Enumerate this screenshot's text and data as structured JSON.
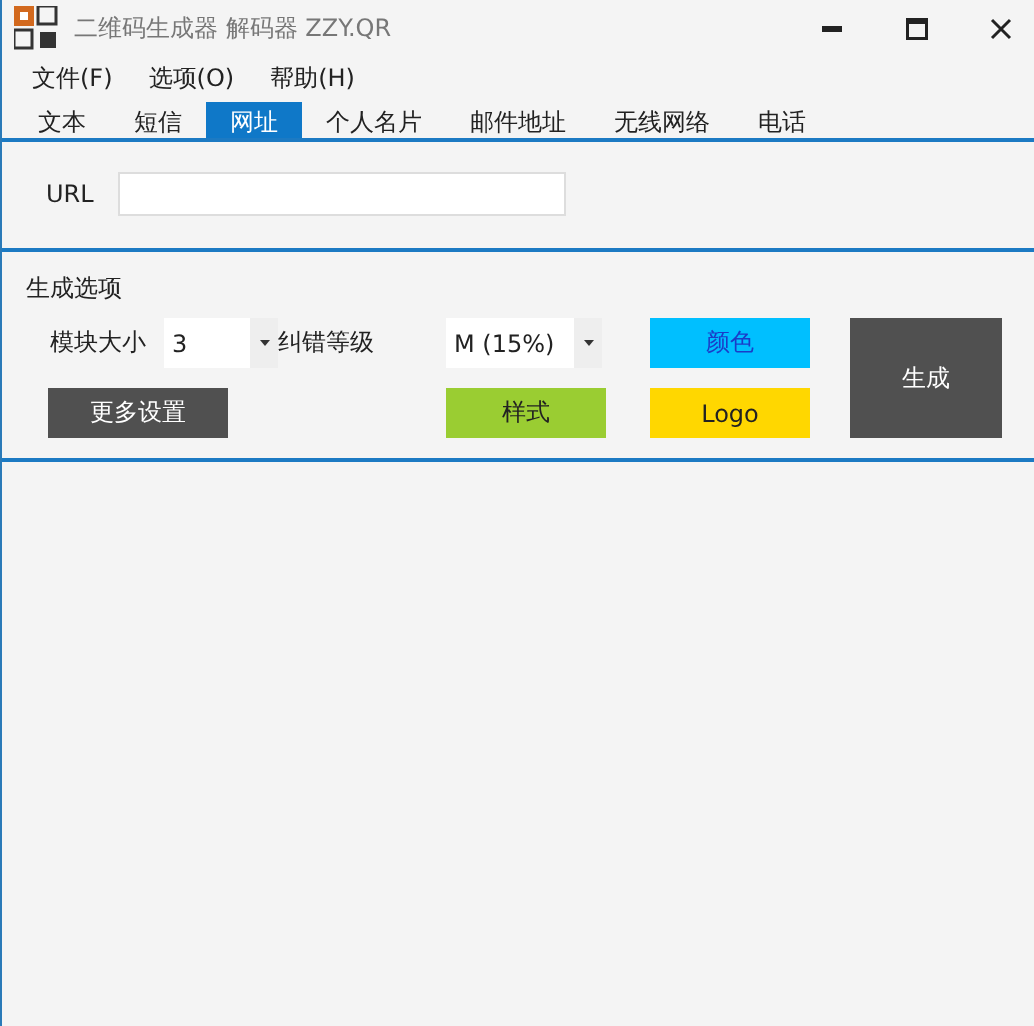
{
  "window": {
    "title": "二维码生成器 解码器 ZZY.QR"
  },
  "menu": [
    "文件(F)",
    "选项(O)",
    "帮助(H)"
  ],
  "tabs": [
    {
      "label": "文本",
      "selected": false
    },
    {
      "label": "短信",
      "selected": false
    },
    {
      "label": "网址",
      "selected": true
    },
    {
      "label": "个人名片",
      "selected": false
    },
    {
      "label": "邮件地址",
      "selected": false
    },
    {
      "label": "无线网络",
      "selected": false
    },
    {
      "label": "电话",
      "selected": false
    }
  ],
  "url_field": {
    "label": "URL"
  },
  "options": {
    "title": "生成选项",
    "module_size": {
      "label": "模块大小",
      "value": "3"
    },
    "error_level": {
      "label": "纠错等级",
      "value": "M (15%)"
    },
    "more_button": "更多设置",
    "style_button": {
      "label": "样式",
      "color": "#9acd32"
    },
    "color_button": {
      "label": "颜色",
      "color": "#00bfff"
    },
    "logo_button": {
      "label": "Logo",
      "color": "#ffd700"
    },
    "generate_button": "生成"
  }
}
